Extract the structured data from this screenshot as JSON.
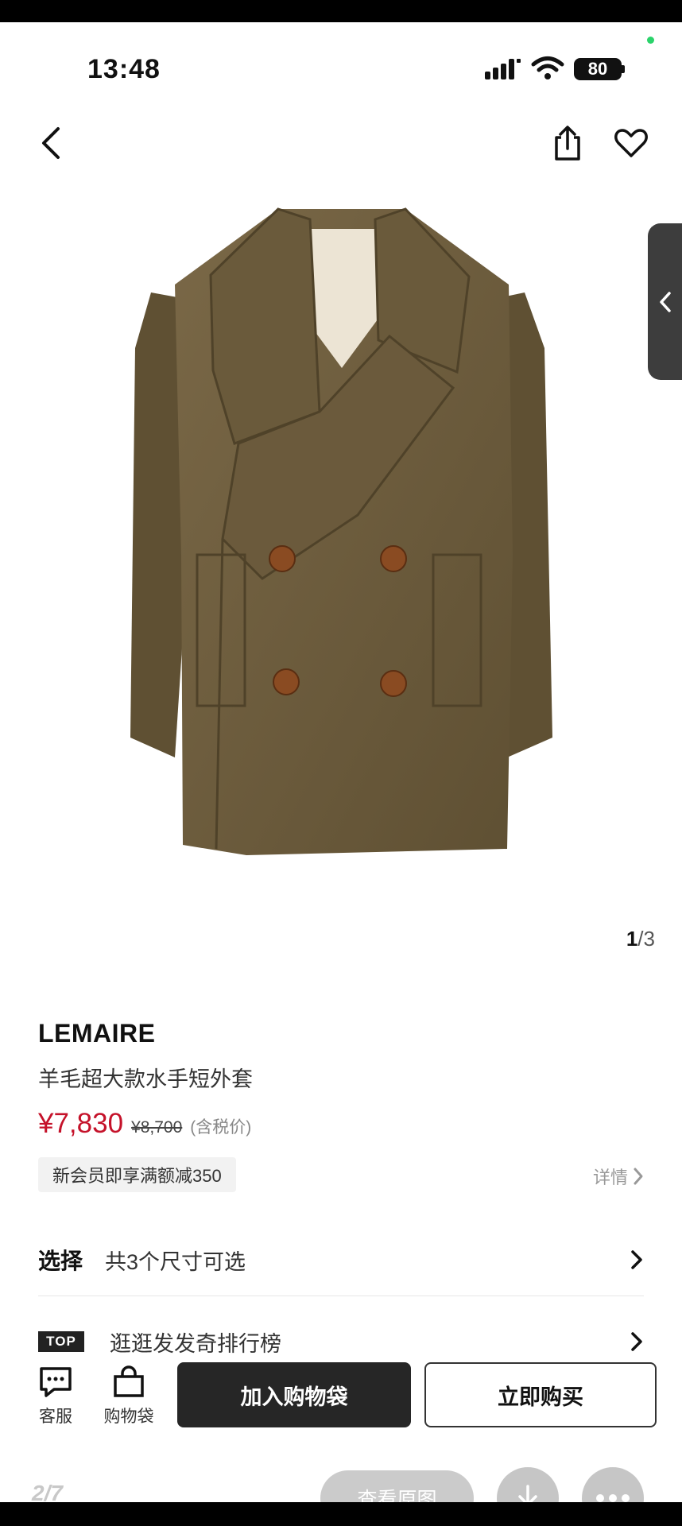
{
  "status_bar": {
    "time": "13:48",
    "battery": "80"
  },
  "product": {
    "image_counter_current": "1",
    "image_counter_separator": "/",
    "image_counter_total": "3",
    "brand": "LEMAIRE",
    "name": "羊毛超大款水手短外套",
    "price": "¥7,830",
    "original_price": "¥8,700",
    "tax_note": "(含税价)",
    "promo": "新会员即享满额减350",
    "promo_detail": "详情"
  },
  "options": {
    "select_label": "选择",
    "select_text": "共3个尺寸可选",
    "rank_badge": "TOP",
    "rank_text": "逛逛发发奇排行榜"
  },
  "bottom_bar": {
    "service_label": "客服",
    "bag_label": "购物袋",
    "add_to_bag": "加入购物袋",
    "buy_now": "立即购买"
  },
  "viewer": {
    "page_index": "2/7",
    "view_original": "查看原图"
  },
  "colors": {
    "price_red": "#c5122a",
    "coat_olive": "#6b5a3c"
  },
  "icons": [
    "back-icon",
    "share-icon",
    "heart-icon",
    "chevron-left-icon",
    "chevron-right-icon",
    "chat-icon",
    "bag-icon",
    "download-icon",
    "more-icon"
  ]
}
